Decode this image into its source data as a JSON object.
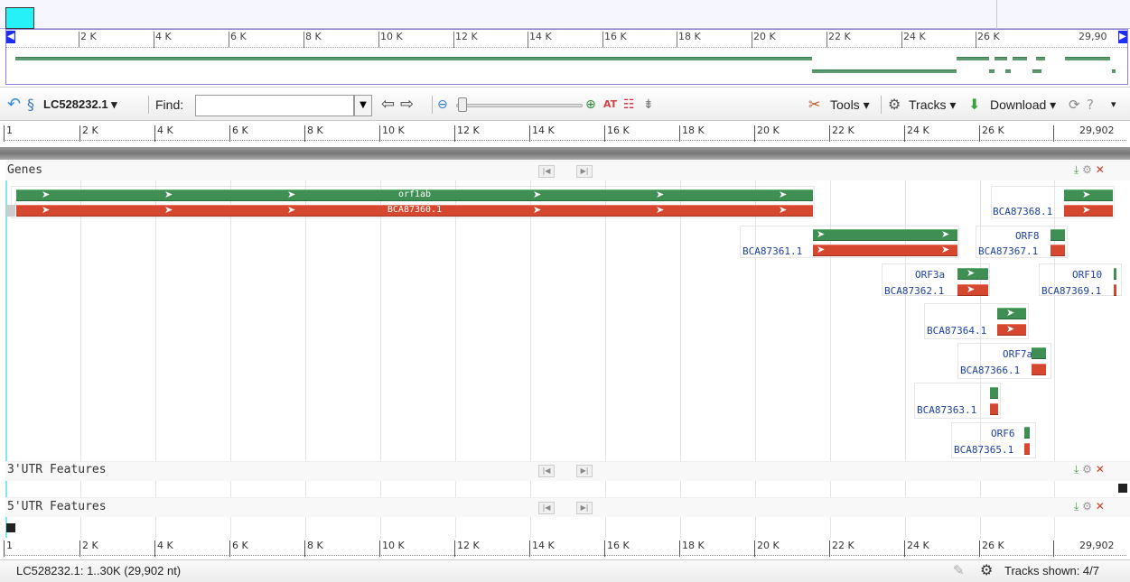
{
  "overview": {
    "ticks": [
      "2 K",
      "4 K",
      "6 K",
      "8 K",
      "10 K",
      "12 K",
      "14 K",
      "16 K",
      "18 K",
      "20 K",
      "22 K",
      "24 K",
      "26 K",
      "29,90"
    ]
  },
  "toolbar": {
    "sequence": "LC528232.1",
    "find_label": "Find:",
    "find_value": "",
    "tools_label": "Tools",
    "tracks_label": "Tracks",
    "download_label": "Download"
  },
  "ruler": {
    "start": "1",
    "ticks": [
      "2 K",
      "4 K",
      "6 K",
      "8 K",
      "10 K",
      "12 K",
      "14 K",
      "16 K",
      "18 K",
      "20 K",
      "22 K",
      "24 K",
      "26 K",
      "29,902"
    ]
  },
  "tracks": {
    "genes": "Genes",
    "utr3": "3'UTR Features",
    "utr5": "5'UTR Features"
  },
  "features": {
    "orf1ab": "orf1ab",
    "bca87360": "BCA87360.1",
    "bca87368": "BCA87368.1",
    "orf8": "ORF8",
    "bca87367": "BCA87367.1",
    "bca87361": "BCA87361.1",
    "orf3a": "ORF3a",
    "bca87362": "BCA87362.1",
    "orf10": "ORF10",
    "bca87369": "BCA87369.1",
    "bca87364": "BCA87364.1",
    "orf7a": "ORF7a",
    "bca87366": "BCA87366.1",
    "bca87363": "BCA87363.1",
    "orf6": "ORF6",
    "bca87365": "BCA87365.1"
  },
  "status": {
    "location": "LC528232.1: 1..30K (29,902 nt)",
    "tracks_shown": "Tracks shown: 4/7"
  },
  "colors": {
    "forward": "#3f8f54",
    "reverse": "#d6472f",
    "accent": "#1e2ef0",
    "highlight": "#26f0f8"
  }
}
